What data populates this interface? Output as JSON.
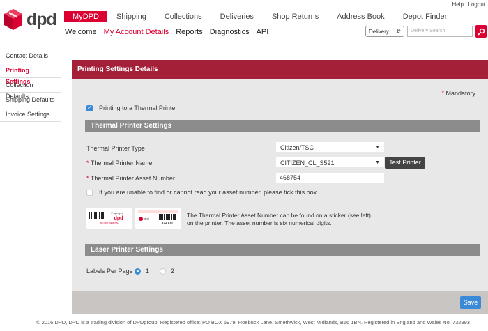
{
  "util": {
    "help": "Help",
    "sep": "|",
    "logout": "Logout"
  },
  "logo": {
    "text": "dpd"
  },
  "nav": {
    "tabs": [
      "MyDPD",
      "Shipping",
      "Collections",
      "Deliveries",
      "Shop Returns",
      "Address Book",
      "Depot Finder"
    ],
    "sub": [
      "Welcome",
      "My Account Details",
      "Reports",
      "Diagnostics",
      "API"
    ]
  },
  "search": {
    "type": "Delivery",
    "placeholder": "Delivery Search"
  },
  "sidebar": {
    "items": [
      "Contact Details",
      "Printing Settings",
      "Collection Defaults",
      "Shipping Defaults",
      "Invoice Settings"
    ]
  },
  "panel": {
    "title": "Printing Settings Details",
    "mandatory_star": "*",
    "mandatory_text": "Mandatory",
    "thermal_checkbox": "Printing to a Thermal Printer",
    "thermal_section": "Thermal Printer Settings",
    "printer_type_label": "Thermal Printer Type",
    "printer_type_value": "Citizen/TSC",
    "printer_name_label": "Thermal Printer Name",
    "printer_name_value": "CITIZEN_CL_S521",
    "test_button": "Test Printer",
    "asset_label": "Thermal Printer Asset Number",
    "asset_value": "468754",
    "asset_checkbox": "If you are unable to find or cannot read your asset number, please tick this box",
    "info_line1": "The Thermal Printer Asset Number can be found on a sticker (see left)",
    "info_line2": "on the printer. The asset number is six numerical digits.",
    "laser_section": "Laser Printer Settings",
    "labels_per_page_label": "Labels Per Page",
    "labels_option1": "1",
    "labels_option2": "2",
    "save": "Save"
  },
  "sticker": {
    "small_text": "DO NOT REMOVE",
    "brand": "dpd",
    "number": "374771"
  },
  "colors": {
    "accent": "#dc0032",
    "panel_header": "#a32038",
    "button_blue": "#3b8ad9"
  },
  "footer": {
    "text": "© 2016 DPD, DPD is a trading division of DPDgroup. Registered office: PO BOX 6979, Roebuck Lane, Smethwick, West Midlands, B66 1BN. Registered in England and Wales No. 732993"
  }
}
